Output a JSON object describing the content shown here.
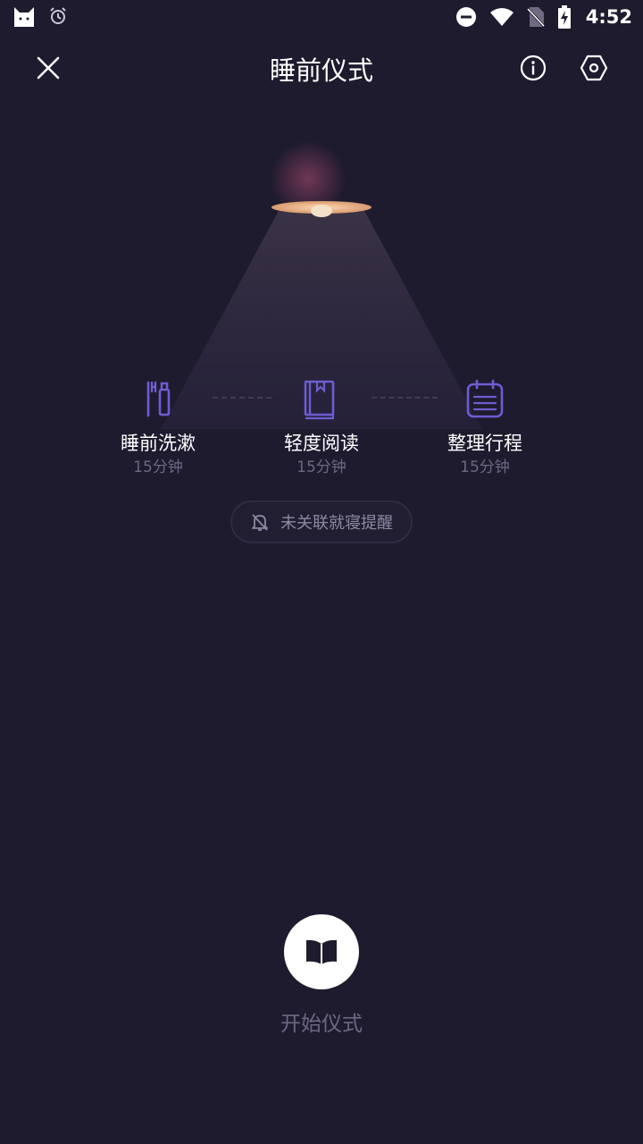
{
  "status_bar": {
    "time": "4:52",
    "icons": [
      "cat-app-icon",
      "alarm-icon",
      "do-not-disturb-icon",
      "wifi-icon",
      "no-sim-icon",
      "battery-charging-icon"
    ]
  },
  "app_bar": {
    "title": "睡前仪式",
    "icons": [
      "close-icon",
      "info-icon",
      "settings-hexagon-icon"
    ]
  },
  "steps": [
    {
      "name": "睡前洗漱",
      "duration": "15分钟",
      "icon": "toothbrush-icon"
    },
    {
      "name": "轻度阅读",
      "duration": "15分钟",
      "icon": "book-icon"
    },
    {
      "name": "整理行程",
      "duration": "15分钟",
      "icon": "calendar-notes-icon"
    }
  ],
  "reminder": {
    "label": "未关联就寝提醒",
    "icon": "bell-off-icon"
  },
  "start": {
    "label": "开始仪式",
    "icon": "open-book-icon"
  },
  "colors": {
    "background": "#1f1b2e",
    "accent_purple": "#6d5dd3",
    "muted_text": "#6c6884",
    "lamp_glow": "#f1b385"
  }
}
